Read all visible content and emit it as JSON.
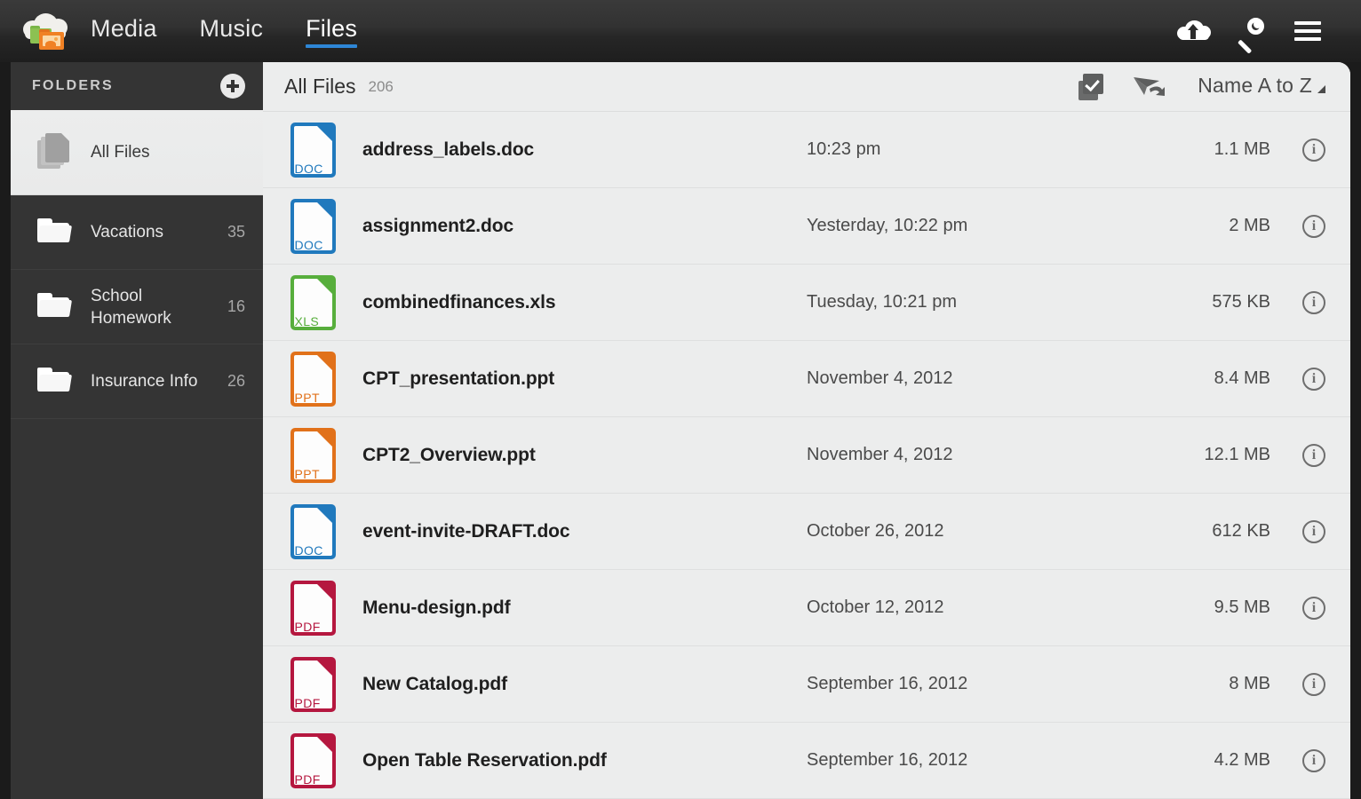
{
  "app": {
    "logo_icon": "cloud-folder-logo",
    "nav_tabs": [
      {
        "label": "Media",
        "active": false
      },
      {
        "label": "Music",
        "active": false
      },
      {
        "label": "Files",
        "active": true
      }
    ],
    "nav_icons": [
      {
        "name": "cloud-upload-icon"
      },
      {
        "name": "key-search-icon"
      },
      {
        "name": "hamburger-menu-icon"
      }
    ],
    "accent_color": "#2e86d6"
  },
  "sidebar": {
    "title": "FOLDERS",
    "add_icon": "plus-circle-icon",
    "items": [
      {
        "label": "All Files",
        "count": "",
        "icon": "stacked-pages-icon",
        "selected": true
      },
      {
        "label": "Vacations",
        "count": "35",
        "icon": "folder-icon",
        "selected": false
      },
      {
        "label": "School Homework",
        "count": "16",
        "icon": "folder-icon",
        "selected": false
      },
      {
        "label": "Insurance Info",
        "count": "26",
        "icon": "folder-icon",
        "selected": false
      }
    ]
  },
  "content": {
    "title": "All Files",
    "count": "206",
    "select_icon": "multi-select-checkbox-icon",
    "share_icon": "share-paper-plane-icon",
    "sort_label": "Name A to Z",
    "sort_caret_icon": "sort-caret-icon",
    "files": [
      {
        "name": "address_labels.doc",
        "date": "10:23 pm",
        "size": "1.1 MB",
        "type": "DOC",
        "color": "#2079bd"
      },
      {
        "name": "assignment2.doc",
        "date": "Yesterday, 10:22 pm",
        "size": "2 MB",
        "type": "DOC",
        "color": "#2079bd"
      },
      {
        "name": "combinedfinances.xls",
        "date": "Tuesday, 10:21 pm",
        "size": "575 KB",
        "type": "XLS",
        "color": "#57ae3c"
      },
      {
        "name": "CPT_presentation.ppt",
        "date": "November 4, 2012",
        "size": "8.4 MB",
        "type": "PPT",
        "color": "#e1711a"
      },
      {
        "name": "CPT2_Overview.ppt",
        "date": "November 4, 2012",
        "size": "12.1 MB",
        "type": "PPT",
        "color": "#e1711a"
      },
      {
        "name": "event-invite-DRAFT.doc",
        "date": "October 26, 2012",
        "size": "612 KB",
        "type": "DOC",
        "color": "#2079bd"
      },
      {
        "name": "Menu-design.pdf",
        "date": "October 12, 2012",
        "size": "9.5 MB",
        "type": "PDF",
        "color": "#b5173f"
      },
      {
        "name": "New Catalog.pdf",
        "date": "September 16, 2012",
        "size": "8 MB",
        "type": "PDF",
        "color": "#b5173f"
      },
      {
        "name": "Open Table Reservation.pdf",
        "date": "September 16, 2012",
        "size": "4.2 MB",
        "type": "PDF",
        "color": "#b5173f"
      }
    ],
    "info_icon": "info-circle-icon",
    "info_glyph": "i"
  }
}
